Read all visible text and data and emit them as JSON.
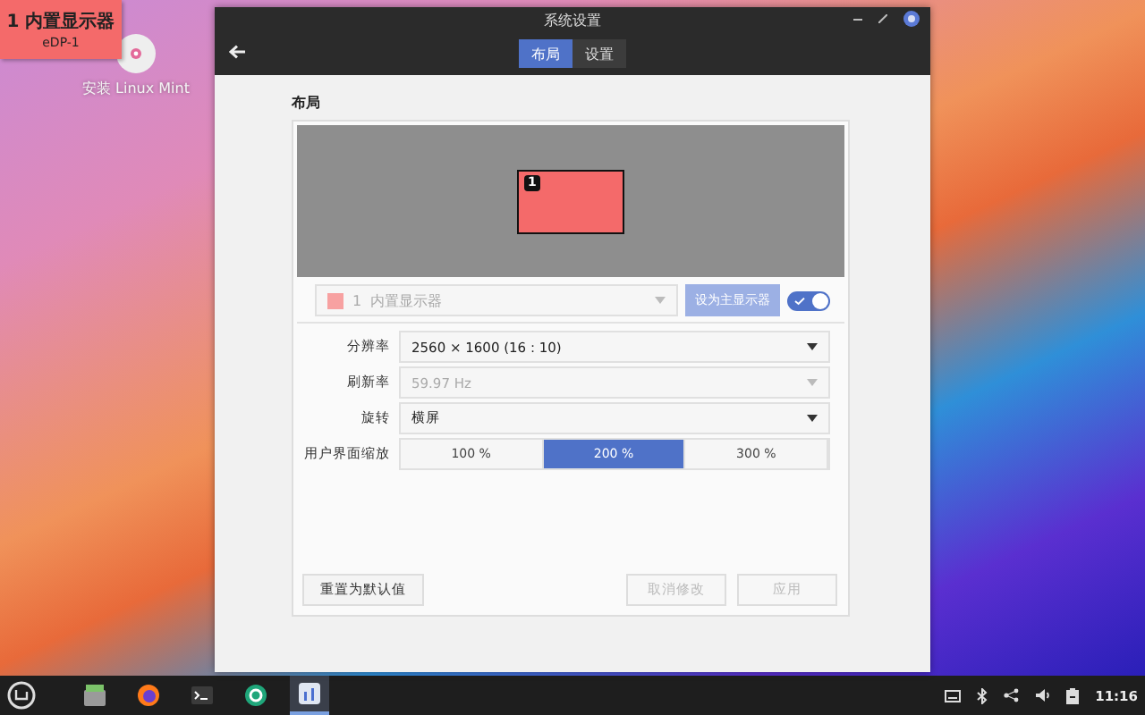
{
  "desktop": {
    "display_label": {
      "title": "1 内置显示器",
      "subtitle": "eDP-1"
    },
    "icons": [
      {
        "label": "安装 Linux Mint"
      }
    ]
  },
  "window": {
    "title": "系统设置",
    "tabs": [
      {
        "label": "布局",
        "selected": true
      },
      {
        "label": "设置",
        "selected": false
      }
    ],
    "section_title": "布局",
    "layout_preview": {
      "monitors": [
        {
          "number": "1"
        }
      ]
    },
    "monitor_row": {
      "number": "1",
      "name": "内置显示器",
      "color": "#f7a1a1",
      "primary_button": {
        "label": "设为主显示器",
        "disabled": true
      },
      "enabled_switch": {
        "on": true
      }
    },
    "settings": [
      {
        "kind": "dropdown",
        "label": "分辨率",
        "value": "2560 × 1600 (16 : 10)",
        "disabled": false
      },
      {
        "kind": "dropdown",
        "label": "刷新率",
        "value": "59.97 Hz",
        "disabled": true
      },
      {
        "kind": "dropdown",
        "label": "旋转",
        "value": "横屏",
        "disabled": false
      },
      {
        "kind": "segmented",
        "label": "用户界面缩放",
        "options": [
          {
            "label": "100 %",
            "selected": false
          },
          {
            "label": "200 %",
            "selected": true
          },
          {
            "label": "300 %",
            "selected": false
          }
        ]
      }
    ],
    "footer_left_buttons": [
      {
        "label": "重置为默认值",
        "disabled": false
      }
    ],
    "footer_right_buttons": [
      {
        "label": "取消修改",
        "disabled": true
      },
      {
        "label": "应用",
        "disabled": true
      }
    ]
  },
  "taskbar": {
    "apps": [
      {
        "kind": "files",
        "selected": false
      },
      {
        "kind": "browser",
        "selected": false
      },
      {
        "kind": "terminal",
        "selected": false
      },
      {
        "kind": "software",
        "selected": false
      },
      {
        "kind": "settings",
        "selected": true
      }
    ],
    "clock": "11:16"
  }
}
